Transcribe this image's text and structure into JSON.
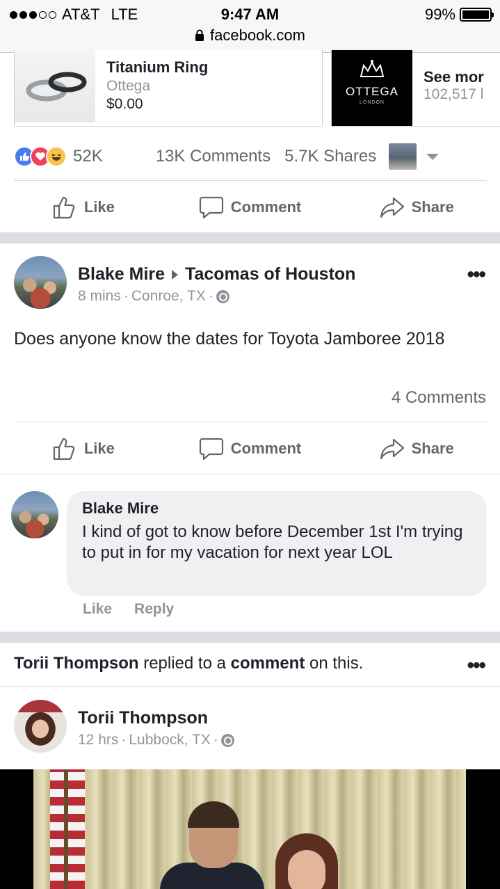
{
  "status_bar": {
    "carrier": "AT&T",
    "network": "LTE",
    "time": "9:47 AM",
    "battery": "99%",
    "url": "facebook.com"
  },
  "carousel": {
    "card1": {
      "title": "Titanium Ring",
      "subtitle": "Ottega",
      "price": "$0.00"
    },
    "card2": {
      "title": "See mor",
      "subtitle": "102,517 l",
      "logo_text": "OTTEGA",
      "logo_sub": "LONDON"
    }
  },
  "reactions": {
    "count": "52K",
    "comments": "13K Comments",
    "shares": "5.7K Shares"
  },
  "actions": {
    "like": "Like",
    "comment": "Comment",
    "share": "Share"
  },
  "post": {
    "author": "Blake Mire",
    "group": "Tacomas of Houston",
    "time": "8 mins",
    "location": "Conroe, TX",
    "sep": "·",
    "text": "Does anyone know the dates for Toyota Jamboree 2018",
    "comments_count": "4 Comments",
    "more": "•••"
  },
  "comment": {
    "author": "Blake Mire",
    "text": "I kind of got to know before December 1st I'm trying to put in for my vacation for next year LOL",
    "like": "Like",
    "reply": "Reply"
  },
  "story_notice": {
    "name": "Torii Thompson",
    "mid": " replied to a ",
    "bold2": "comment",
    "end": " on this."
  },
  "post2": {
    "author": "Torii Thompson",
    "time": "12 hrs",
    "location": "Lubbock, TX",
    "sep": "·"
  },
  "colors": {
    "like_blue": "#4a7bf2",
    "love_red": "#f0405b",
    "haha_yellow": "#f7c44f",
    "text_gray": "#606770",
    "meta_gray": "#90949c"
  }
}
